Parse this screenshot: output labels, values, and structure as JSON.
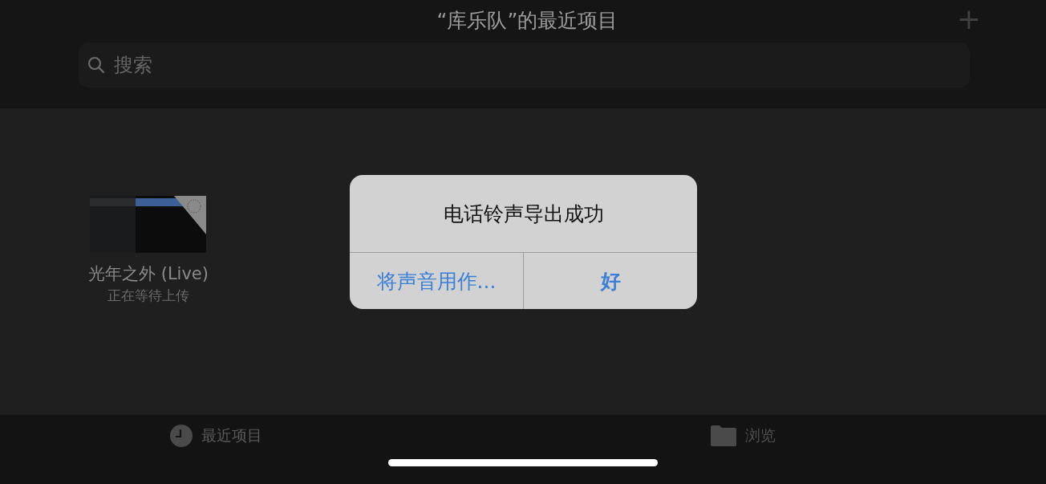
{
  "header": {
    "title": "“库乐队”的最近项目",
    "add_button": "+"
  },
  "search": {
    "placeholder": "搜索"
  },
  "projects": [
    {
      "name": "光年之外 (Live)",
      "status": "正在等待上传"
    }
  ],
  "alert": {
    "title": "电话铃声导出成功",
    "buttons": [
      "将声音用作...",
      "好"
    ]
  },
  "tabs": [
    {
      "label": "最近项目",
      "kind": "clock",
      "selected": true
    },
    {
      "label": "浏览",
      "kind": "folder",
      "selected": false
    }
  ]
}
